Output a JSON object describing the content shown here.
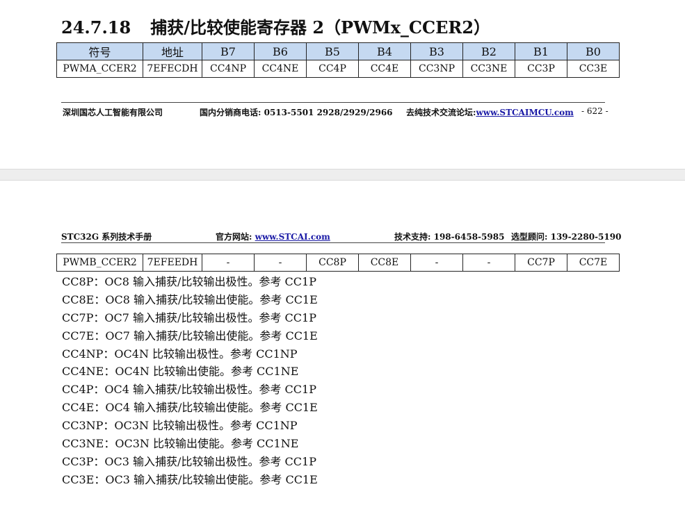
{
  "section": {
    "number": "24.7.18",
    "title": "捕获/比较使能寄存器 2（PWMx_CCER2）"
  },
  "register_table": {
    "headers": [
      "符号",
      "地址",
      "B7",
      "B6",
      "B5",
      "B4",
      "B3",
      "B2",
      "B1",
      "B0"
    ],
    "row_a": [
      "PWMA_CCER2",
      "7EFECDH",
      "CC4NP",
      "CC4NE",
      "CC4P",
      "CC4E",
      "CC3NP",
      "CC3NE",
      "CC3P",
      "CC3E"
    ],
    "row_b": [
      "PWMB_CCER2",
      "7EFEEDH",
      "-",
      "-",
      "CC8P",
      "CC8E",
      "-",
      "-",
      "CC7P",
      "CC7E"
    ]
  },
  "footer": {
    "company": "深圳国芯人工智能有限公司",
    "distributor_label": "国内分销商电话: ",
    "distributor_phone": "0513-5501 2928/2929/2966",
    "forum_label": "去纯技术交流论坛:",
    "forum_url": "www.STCAIMCU.com",
    "page": "- 622 -"
  },
  "header": {
    "manual": "STC32G 系列技术手册",
    "site_label": "官方网站: ",
    "site_url": "www.STCAI.com",
    "support_label": "技术支持: ",
    "support_phone": "198-6458-5985",
    "consult_label": "选型顾问: ",
    "consult_phone": "139-2280-5190"
  },
  "descriptions": [
    "CC8P：OC8 输入捕获/比较输出极性。参考 CC1P",
    "CC8E：OC8 输入捕获/比较输出使能。参考 CC1E",
    "CC7P：OC7 输入捕获/比较输出极性。参考 CC1P",
    "CC7E：OC7 输入捕获/比较输出使能。参考 CC1E",
    "CC4NP：OC4N 比较输出极性。参考 CC1NP",
    "CC4NE：OC4N 比较输出使能。参考 CC1NE",
    "CC4P：OC4 输入捕获/比较输出极性。参考 CC1P",
    "CC4E：OC4 输入捕获/比较输出使能。参考 CC1E",
    "CC3NP：OC3N 比较输出极性。参考 CC1NP",
    "CC3NE：OC3N 比较输出使能。参考 CC1NE",
    "CC3P：OC3 输入捕获/比较输出极性。参考 CC1P",
    "CC3E：OC3 输入捕获/比较输出使能。参考 CC1E"
  ]
}
